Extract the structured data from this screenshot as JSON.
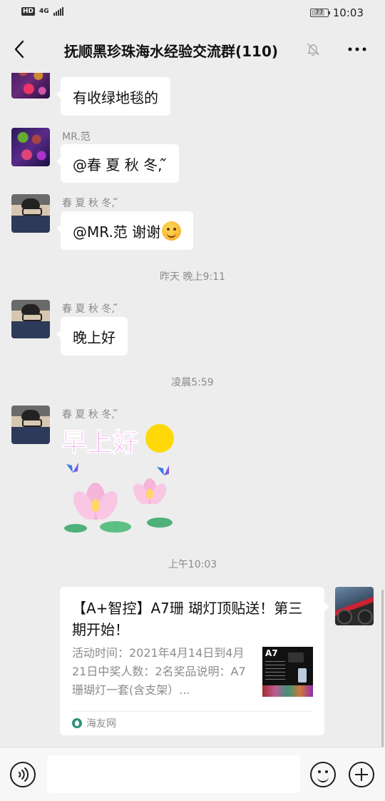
{
  "status_bar": {
    "hd_label": "HD",
    "network_label": "4G",
    "battery_level": "77",
    "time": "10:03"
  },
  "header": {
    "title": "抚顺黑珍珠海水经验交流群(110)",
    "back_icon": "chevron-left-icon",
    "mute_icon": "bell-off-icon",
    "more_icon": "ellipsis-icon"
  },
  "messages": [
    {
      "sender": "",
      "text": "有收绿地毯的"
    },
    {
      "sender": "MR.范",
      "text": "@春 夏 秋 冬, ᷉"
    },
    {
      "sender": "春 夏 秋 冬, ᷉",
      "text": "@MR.范  谢谢",
      "emoji": "smiling-face-icon"
    },
    {
      "sender": "春 夏 秋 冬, ᷉",
      "text": "晚上好"
    },
    {
      "sender": "春 夏 秋 冬, ᷉",
      "sticker_text": "早上好",
      "sticker": "lotus-butterfly-sticker"
    }
  ],
  "timestamps": {
    "t1": "昨天 晚上9:11",
    "t2": "凌晨5:59",
    "t3": "上午10:03"
  },
  "link_card": {
    "title": "【A+智控】A7珊 瑚灯顶贴送！第三期开始！",
    "description": "活动时间：2021年4月14日到4月21日中奖人数：2名奖品说明：A7珊瑚灯一套(含支架）...",
    "thumb_label": "A7",
    "source": "海友网"
  },
  "input_bar": {
    "voice_icon": "voice-icon",
    "placeholder": "",
    "emoji_icon": "emoji-icon",
    "plus_icon": "plus-icon"
  },
  "colors": {
    "chat_background": "#ededed",
    "bubble": "#ffffff",
    "timestamp_text": "#8a8a8a",
    "sticker_text": "#e91ee0"
  }
}
